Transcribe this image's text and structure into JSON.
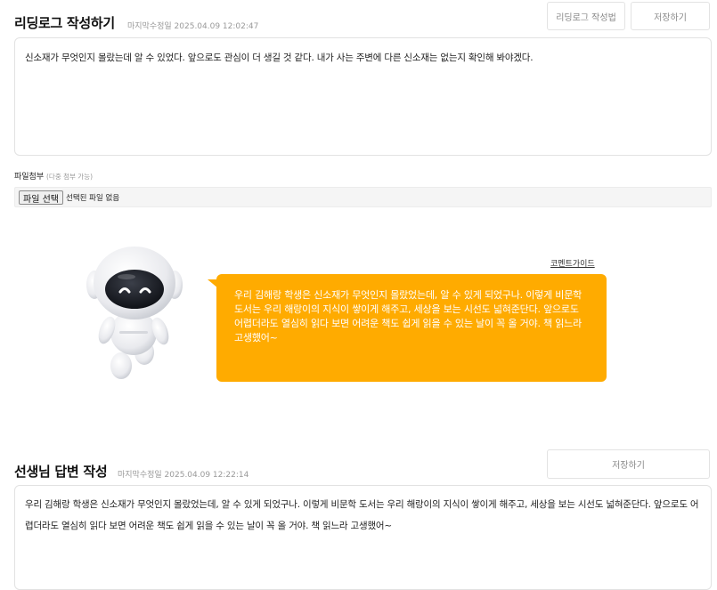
{
  "reading_log": {
    "title": "리딩로그 작성하기",
    "modified": "마지막수정일 2025.04.09 12:02:47",
    "guide_button": "리딩로그 작성법",
    "save_button": "저장하기",
    "content": "신소재가 무엇인지 몰랐는데 알 수 있었다. 앞으로도 관심이 더 생길 것 같다. 내가 사는 주변에 다른 신소재는 없는지 확인해 봐야겠다."
  },
  "attachment": {
    "label": "파일첨부",
    "note": "(다중 첨부 가능)",
    "choose_button": "파일 선택",
    "status": "선택된 파일 없음"
  },
  "ai_comment": {
    "guide_link": "코멘트가이드",
    "text": "우리 김해랑 학생은 신소재가 무엇인지 몰랐었는데, 알 수 있게 되었구나. 이렇게 비문학 도서는 우리 해랑이의 지식이 쌓이게 해주고, 세상을 보는 시선도 넓혀준단다. 앞으로도 어렵더라도 열심히 읽다 보면 어려운 책도 쉽게 읽을 수 있는 날이 꼭 올 거야. 책 읽느라 고생했어~"
  },
  "teacher_reply": {
    "title": "선생님 답변 작성",
    "modified": "마지막수정일 2025.04.09 12:22:14",
    "save_button": "저장하기",
    "content": "우리 김해랑 학생은 신소재가 무엇인지 몰랐었는데, 알 수 있게 되었구나. 이렇게 비문학 도서는 우리 해랑이의 지식이 쌓이게 해주고, 세상을 보는 시선도 넓혀준단다. 앞으로도 어렵더라도 열심히 읽다 보면 어려운 책도 쉽게 읽을 수 있는 날이 꼭 올 거야. 책 읽느라 고생했어~"
  },
  "colors": {
    "bubble": "#ffab00",
    "border": "#e2e2e2",
    "title": "#111111"
  },
  "icons": {
    "mascot": "robot-mascot"
  }
}
